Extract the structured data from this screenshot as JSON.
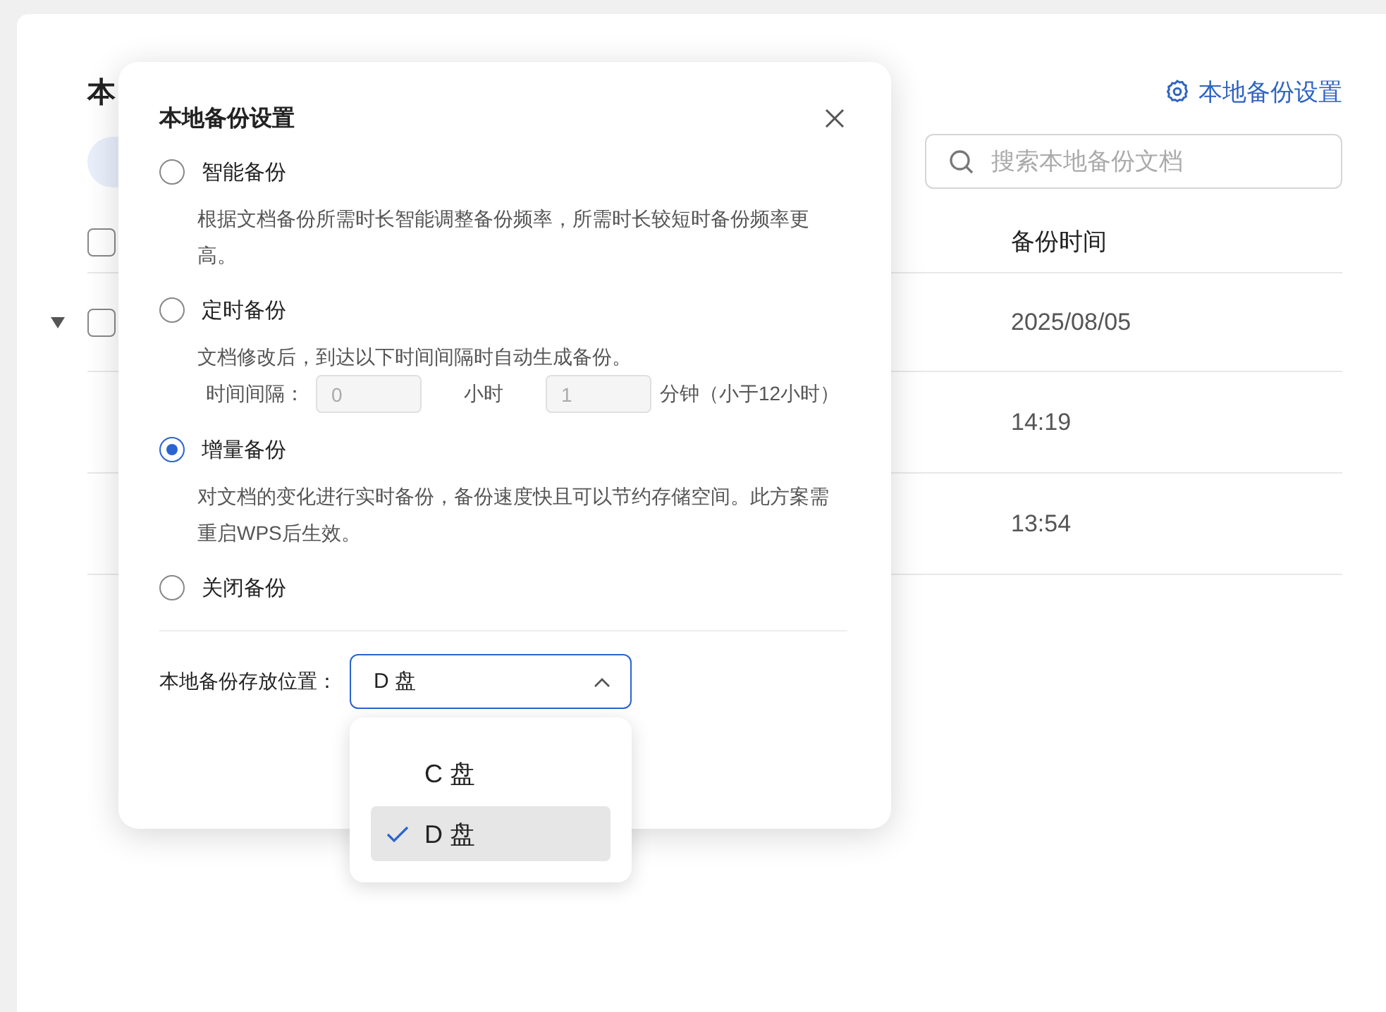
{
  "page": {
    "title": "本",
    "settings_link": "本地备份设置",
    "search": {
      "placeholder": "搜索本地备份文档"
    },
    "table": {
      "header_checked": false,
      "columns": [
        "备份时间"
      ],
      "rows": [
        {
          "kind": "group",
          "expanded": true,
          "checked": false,
          "time": "2025/08/05"
        },
        {
          "kind": "item",
          "time": "14:19"
        },
        {
          "kind": "item",
          "time": "13:54"
        }
      ]
    }
  },
  "dialog": {
    "title": "本地备份设置",
    "options": [
      {
        "label": "智能备份",
        "selected": false,
        "description": "根据文档备份所需时长智能调整备份频率，所需时长较短时备份频率更高。"
      },
      {
        "label": "定时备份",
        "selected": false,
        "description": "文档修改后，到达以下时间间隔时自动生成备份。",
        "interval": {
          "label": "时间间隔：",
          "hours": "0",
          "hours_unit": "小时",
          "minutes": "1",
          "minutes_unit": "分钟（小于12小时）",
          "disabled": true
        }
      },
      {
        "label": "增量备份",
        "selected": true,
        "description": "对文档的变化进行实时备份，备份速度快且可以节约存储空间。此方案需重启WPS后生效。"
      },
      {
        "label": "关闭备份",
        "selected": false
      }
    ],
    "location": {
      "label": "本地备份存放位置：",
      "value": "D 盘",
      "expanded": true,
      "options": [
        {
          "label": "C 盘",
          "selected": false
        },
        {
          "label": "D 盘",
          "selected": true
        }
      ]
    }
  }
}
